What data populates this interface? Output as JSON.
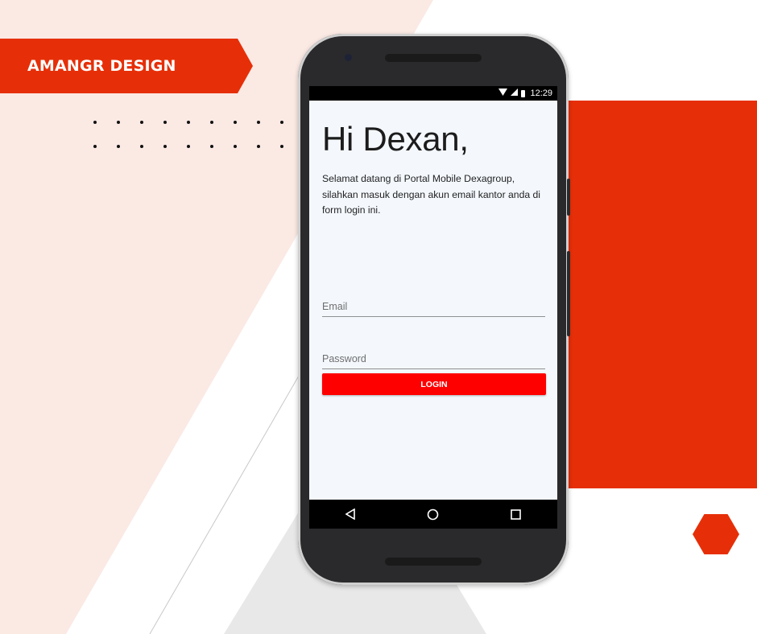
{
  "brand": {
    "label": "AMANGR DESIGN"
  },
  "colors": {
    "accent": "#e62f08",
    "blush_background": "#fbe9e4",
    "screen_background": "#f4f8fd",
    "login_button": "#ff0000"
  },
  "status_bar": {
    "time": "12:29",
    "icons": [
      "wifi-icon",
      "signal-icon",
      "battery-icon"
    ]
  },
  "login_screen": {
    "greeting": "Hi Dexan,",
    "intro": "Selamat datang di Portal Mobile Dexagroup, silahkan masuk dengan akun email kantor anda di form login ini.",
    "email_placeholder": "Email",
    "email_value": "",
    "password_placeholder": "Password",
    "password_value": "",
    "login_label": "LOGIN"
  },
  "navigation": {
    "buttons": [
      "back-icon",
      "home-icon",
      "recents-icon"
    ]
  }
}
